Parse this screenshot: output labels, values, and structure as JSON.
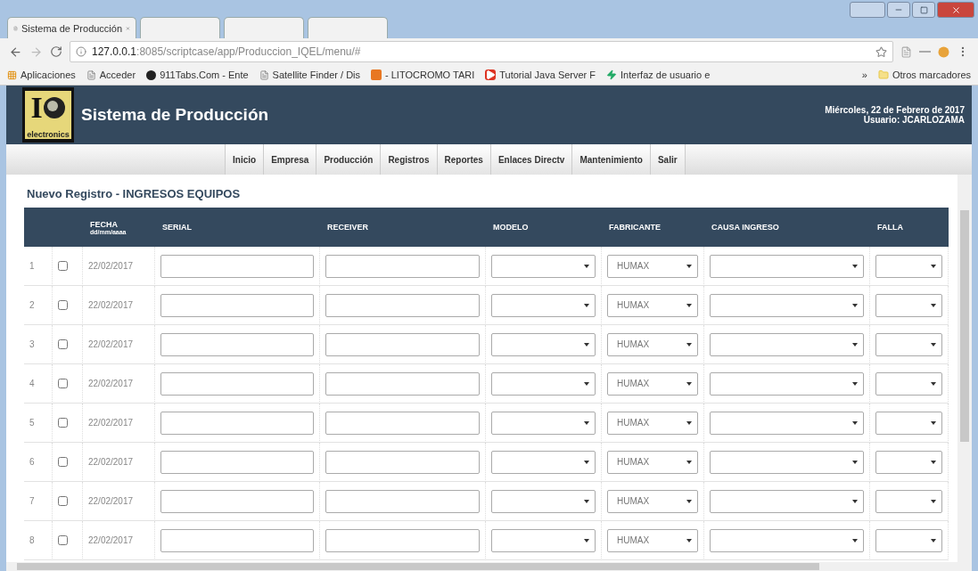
{
  "browser": {
    "tabs": [
      {
        "title": "Sistema de Producción",
        "selected": true
      },
      {
        "selected": false
      },
      {
        "selected": false
      },
      {
        "selected": false
      }
    ],
    "url_host": "127.0.0.1",
    "url_path": ":8085/scriptcase/app/Produccion_IQEL/menu/#",
    "bookmarks": [
      {
        "label": "Aplicaciones",
        "kind": "apps"
      },
      {
        "label": "Acceder",
        "kind": "page"
      },
      {
        "label": "911Tabs.Com - Ente",
        "kind": "dark"
      },
      {
        "label": "Satellite Finder / Dis",
        "kind": "page"
      },
      {
        "label": "- LITOCROMO TARI",
        "kind": "orange"
      },
      {
        "label": "Tutorial Java Server F",
        "kind": "video"
      },
      {
        "label": "Interfaz de usuario e",
        "kind": "bolt"
      }
    ],
    "more": "»",
    "other_bookmarks": "Otros marcadores"
  },
  "header": {
    "logo_text": "electronics",
    "logo_letter": "I",
    "title": "Sistema de Producción",
    "date": "Miércoles, 22 de Febrero de 2017",
    "user": "Usuario: JCARLOZAMA"
  },
  "menu": [
    {
      "label": "Inicio",
      "selected": false
    },
    {
      "label": "Empresa",
      "selected": false
    },
    {
      "label": "Producción",
      "selected": false
    },
    {
      "label": "Registros",
      "selected": false
    },
    {
      "label": "Reportes",
      "selected": false
    },
    {
      "label": "Enlaces Directv",
      "selected": false
    },
    {
      "label": "Mantenimiento",
      "selected": false
    },
    {
      "label": "Salir",
      "selected": false
    }
  ],
  "form_title": "Nuevo Registro - INGRESOS EQUIPOS",
  "table": {
    "columns": [
      {
        "label": "FECHA",
        "sub": "dd/mm/aaaa"
      },
      {
        "label": "SERIAL"
      },
      {
        "label": "RECEIVER"
      },
      {
        "label": "MODELO"
      },
      {
        "label": "FABRICANTE"
      },
      {
        "label": "CAUSA INGRESO"
      },
      {
        "label": "FALLA"
      }
    ],
    "rows": [
      {
        "number": "1",
        "checked": false,
        "date": "22/02/2017",
        "fabricante": "HUMAX"
      },
      {
        "number": "2",
        "checked": false,
        "date": "22/02/2017",
        "fabricante": "HUMAX"
      },
      {
        "number": "3",
        "checked": false,
        "date": "22/02/2017",
        "fabricante": "HUMAX"
      },
      {
        "number": "4",
        "checked": false,
        "date": "22/02/2017",
        "fabricante": "HUMAX"
      },
      {
        "number": "5",
        "checked": false,
        "date": "22/02/2017",
        "fabricante": "HUMAX"
      },
      {
        "number": "6",
        "checked": false,
        "date": "22/02/2017",
        "fabricante": "HUMAX"
      },
      {
        "number": "7",
        "checked": false,
        "date": "22/02/2017",
        "fabricante": "HUMAX"
      },
      {
        "number": "8",
        "checked": false,
        "date": "22/02/2017",
        "fabricante": "HUMAX"
      }
    ]
  }
}
